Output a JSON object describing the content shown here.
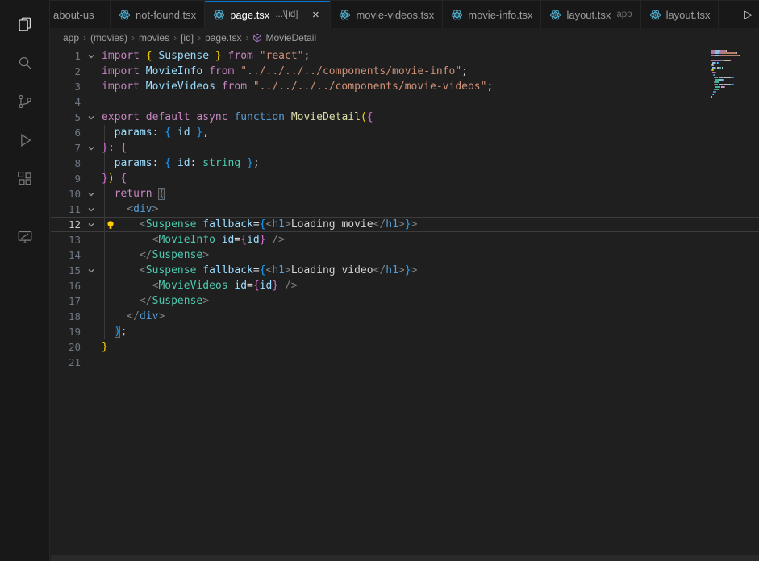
{
  "colors": {
    "accent": "#0078d4",
    "editor_bg": "#1f1f1f",
    "panel_bg": "#181818",
    "react_icon": "#53B7D7",
    "lightbulb": "#FFCC00",
    "current_line_border": "#3c3c3c"
  },
  "palette": {
    "k": "#C586C0",
    "st": "#569CD6",
    "fn": "#DCDCAA",
    "v": "#9CDCFE",
    "s": "#CE9178",
    "p": "#D4D4D4",
    "tp": "#808080",
    "tag": "#569CD6",
    "cp": "#4EC9B0",
    "ty": "#4EC9B0",
    "at": "#9CDCFE",
    "b1": "#FFD700",
    "b2": "#DA70D6",
    "b3": "#179FFF",
    "tx": "#D4D4D4"
  },
  "activity_bar": {
    "items": [
      {
        "name": "explorer",
        "active": true
      },
      {
        "name": "search",
        "active": false
      },
      {
        "name": "source-control",
        "active": false
      },
      {
        "name": "run-and-debug",
        "active": false
      },
      {
        "name": "extensions",
        "active": false
      },
      {
        "name": "remote-explorer",
        "active": false
      }
    ]
  },
  "tab_bar": {
    "close_glyph": "×",
    "run_glyph": "▷",
    "tabs": [
      {
        "label": "about-us",
        "desc": "",
        "active": false
      },
      {
        "label": "not-found.tsx",
        "desc": "",
        "active": false
      },
      {
        "label": "page.tsx",
        "desc": "...\\[id]",
        "active": true
      },
      {
        "label": "movie-videos.tsx",
        "desc": "",
        "active": false
      },
      {
        "label": "movie-info.tsx",
        "desc": "",
        "active": false
      },
      {
        "label": "layout.tsx",
        "desc": "app",
        "active": false
      },
      {
        "label": "layout.tsx",
        "desc": "",
        "active": false
      }
    ]
  },
  "breadcrumbs": {
    "separator": "›",
    "items": [
      "app",
      "(movies)",
      "movies",
      "[id]",
      "page.tsx"
    ],
    "symbol": {
      "name": "MovieDetail"
    }
  },
  "editor": {
    "current_line": 12,
    "lightbulb_line": 12,
    "fold_lines": [
      1,
      5,
      7,
      10,
      11,
      12,
      15
    ],
    "lines": [
      {
        "n": 1,
        "tokens": [
          [
            "k",
            "import "
          ],
          [
            "b1",
            "{"
          ],
          [
            "v",
            " Suspense "
          ],
          [
            "b1",
            "}"
          ],
          [
            "k",
            " from "
          ],
          [
            "s",
            "\"react\""
          ],
          [
            "p",
            ";"
          ]
        ]
      },
      {
        "n": 2,
        "tokens": [
          [
            "k",
            "import "
          ],
          [
            "v",
            "MovieInfo"
          ],
          [
            "k",
            " from "
          ],
          [
            "s",
            "\"../../../../components/movie-info\""
          ],
          [
            "p",
            ";"
          ]
        ]
      },
      {
        "n": 3,
        "tokens": [
          [
            "k",
            "import "
          ],
          [
            "v",
            "MovieVideos"
          ],
          [
            "k",
            " from "
          ],
          [
            "s",
            "\"../../../../components/movie-videos\""
          ],
          [
            "p",
            ";"
          ]
        ]
      },
      {
        "n": 4,
        "tokens": []
      },
      {
        "n": 5,
        "tokens": [
          [
            "k",
            "export default async "
          ],
          [
            "st",
            "function "
          ],
          [
            "fn",
            "MovieDetail"
          ],
          [
            "b1",
            "("
          ],
          [
            "b2",
            "{"
          ]
        ]
      },
      {
        "n": 6,
        "tokens": [
          [
            "v",
            "  params"
          ],
          [
            "p",
            ": "
          ],
          [
            "b3",
            "{"
          ],
          [
            "v",
            " id "
          ],
          [
            "b3",
            "}"
          ],
          [
            "p",
            ","
          ]
        ]
      },
      {
        "n": 7,
        "tokens": [
          [
            "b2",
            "}"
          ],
          [
            "p",
            ": "
          ],
          [
            "b2",
            "{"
          ]
        ]
      },
      {
        "n": 8,
        "tokens": [
          [
            "v",
            "  params"
          ],
          [
            "p",
            ": "
          ],
          [
            "b3",
            "{"
          ],
          [
            "v",
            " id"
          ],
          [
            "p",
            ": "
          ],
          [
            "ty",
            "string"
          ],
          [
            "b3",
            " }"
          ],
          [
            "p",
            ";"
          ]
        ]
      },
      {
        "n": 9,
        "tokens": [
          [
            "b2",
            "}"
          ],
          [
            "b1",
            ")"
          ],
          [
            "p",
            " "
          ],
          [
            "b2",
            "{"
          ]
        ]
      },
      {
        "n": 10,
        "tokens": [
          [
            "k",
            "  return "
          ],
          [
            "b3",
            "(",
            "box"
          ]
        ]
      },
      {
        "n": 11,
        "tokens": [
          [
            "tp",
            "    <"
          ],
          [
            "tag",
            "div"
          ],
          [
            "tp",
            ">"
          ]
        ]
      },
      {
        "n": 12,
        "tokens": [
          [
            "tp",
            "      <"
          ],
          [
            "cp",
            "Suspense"
          ],
          [
            "at",
            " fallback"
          ],
          [
            "p",
            "="
          ],
          [
            "b3",
            "{"
          ],
          [
            "tp",
            "<"
          ],
          [
            "tag",
            "h1"
          ],
          [
            "tp",
            ">"
          ],
          [
            "tx",
            "Loading movie"
          ],
          [
            "tp",
            "</"
          ],
          [
            "tag",
            "h1"
          ],
          [
            "tp",
            ">"
          ],
          [
            "b3",
            "}"
          ],
          [
            "tp",
            ">"
          ]
        ]
      },
      {
        "n": 13,
        "tokens": [
          [
            "tp",
            "        <"
          ],
          [
            "cp",
            "MovieInfo"
          ],
          [
            "at",
            " id"
          ],
          [
            "p",
            "="
          ],
          [
            "b2",
            "{"
          ],
          [
            "v",
            "id"
          ],
          [
            "b2",
            "}"
          ],
          [
            "tp",
            " />"
          ]
        ]
      },
      {
        "n": 14,
        "tokens": [
          [
            "tp",
            "      </"
          ],
          [
            "cp",
            "Suspense"
          ],
          [
            "tp",
            ">"
          ]
        ]
      },
      {
        "n": 15,
        "tokens": [
          [
            "tp",
            "      <"
          ],
          [
            "cp",
            "Suspense"
          ],
          [
            "at",
            " fallback"
          ],
          [
            "p",
            "="
          ],
          [
            "b3",
            "{"
          ],
          [
            "tp",
            "<"
          ],
          [
            "tag",
            "h1"
          ],
          [
            "tp",
            ">"
          ],
          [
            "tx",
            "Loading video"
          ],
          [
            "tp",
            "</"
          ],
          [
            "tag",
            "h1"
          ],
          [
            "tp",
            ">"
          ],
          [
            "b3",
            "}"
          ],
          [
            "tp",
            ">"
          ]
        ]
      },
      {
        "n": 16,
        "tokens": [
          [
            "tp",
            "        <"
          ],
          [
            "cp",
            "MovieVideos"
          ],
          [
            "at",
            " id"
          ],
          [
            "p",
            "="
          ],
          [
            "b2",
            "{"
          ],
          [
            "v",
            "id"
          ],
          [
            "b2",
            "}"
          ],
          [
            "tp",
            " />"
          ]
        ]
      },
      {
        "n": 17,
        "tokens": [
          [
            "tp",
            "      </"
          ],
          [
            "cp",
            "Suspense"
          ],
          [
            "tp",
            ">"
          ]
        ]
      },
      {
        "n": 18,
        "tokens": [
          [
            "tp",
            "    </"
          ],
          [
            "tag",
            "div"
          ],
          [
            "tp",
            ">"
          ]
        ]
      },
      {
        "n": 19,
        "tokens": [
          [
            "p",
            "  "
          ],
          [
            "b3",
            ")",
            "box"
          ],
          [
            "p",
            ";"
          ]
        ]
      },
      {
        "n": 20,
        "tokens": [
          [
            "b1",
            "}"
          ]
        ]
      },
      {
        "n": 21,
        "tokens": []
      }
    ]
  }
}
